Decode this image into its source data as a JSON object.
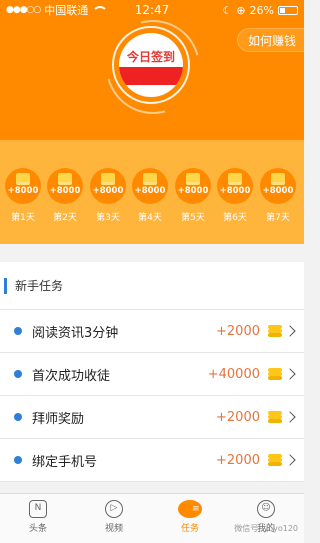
{
  "statusbar": {
    "carrier": "中国联通",
    "time": "12:47",
    "battery": "26%"
  },
  "header": {
    "signin_label": "今日签到",
    "howto_label": "如何赚钱"
  },
  "days": [
    {
      "amount": "+8000",
      "label": "第1天"
    },
    {
      "amount": "+8000",
      "label": "第2天"
    },
    {
      "amount": "+8000",
      "label": "第3天"
    },
    {
      "amount": "+8000",
      "label": "第4天"
    },
    {
      "amount": "+8000",
      "label": "第5天"
    },
    {
      "amount": "+8000",
      "label": "第6天"
    },
    {
      "amount": "+8000",
      "label": "第7天"
    }
  ],
  "tasks_section": {
    "title": "新手任务",
    "items": [
      {
        "name": "阅读资讯3分钟",
        "reward": "+2000"
      },
      {
        "name": "首次成功收徒",
        "reward": "+40000"
      },
      {
        "name": "拜师奖励",
        "reward": "+2000"
      },
      {
        "name": "绑定手机号",
        "reward": "+2000"
      }
    ]
  },
  "tabbar": {
    "tabs": [
      {
        "label": "头条",
        "icon": "N"
      },
      {
        "label": "视频",
        "icon": "▷"
      },
      {
        "label": "任务",
        "icon": "≡"
      },
      {
        "label": "我的",
        "icon": "☺"
      }
    ],
    "active_index": 2
  },
  "watermark": "微信号: yoyo120",
  "colors": {
    "header": "#ff8a00",
    "days_bg": "#ffb53c",
    "accent_blue": "#2f7fd9",
    "reward": "#e5743d"
  }
}
